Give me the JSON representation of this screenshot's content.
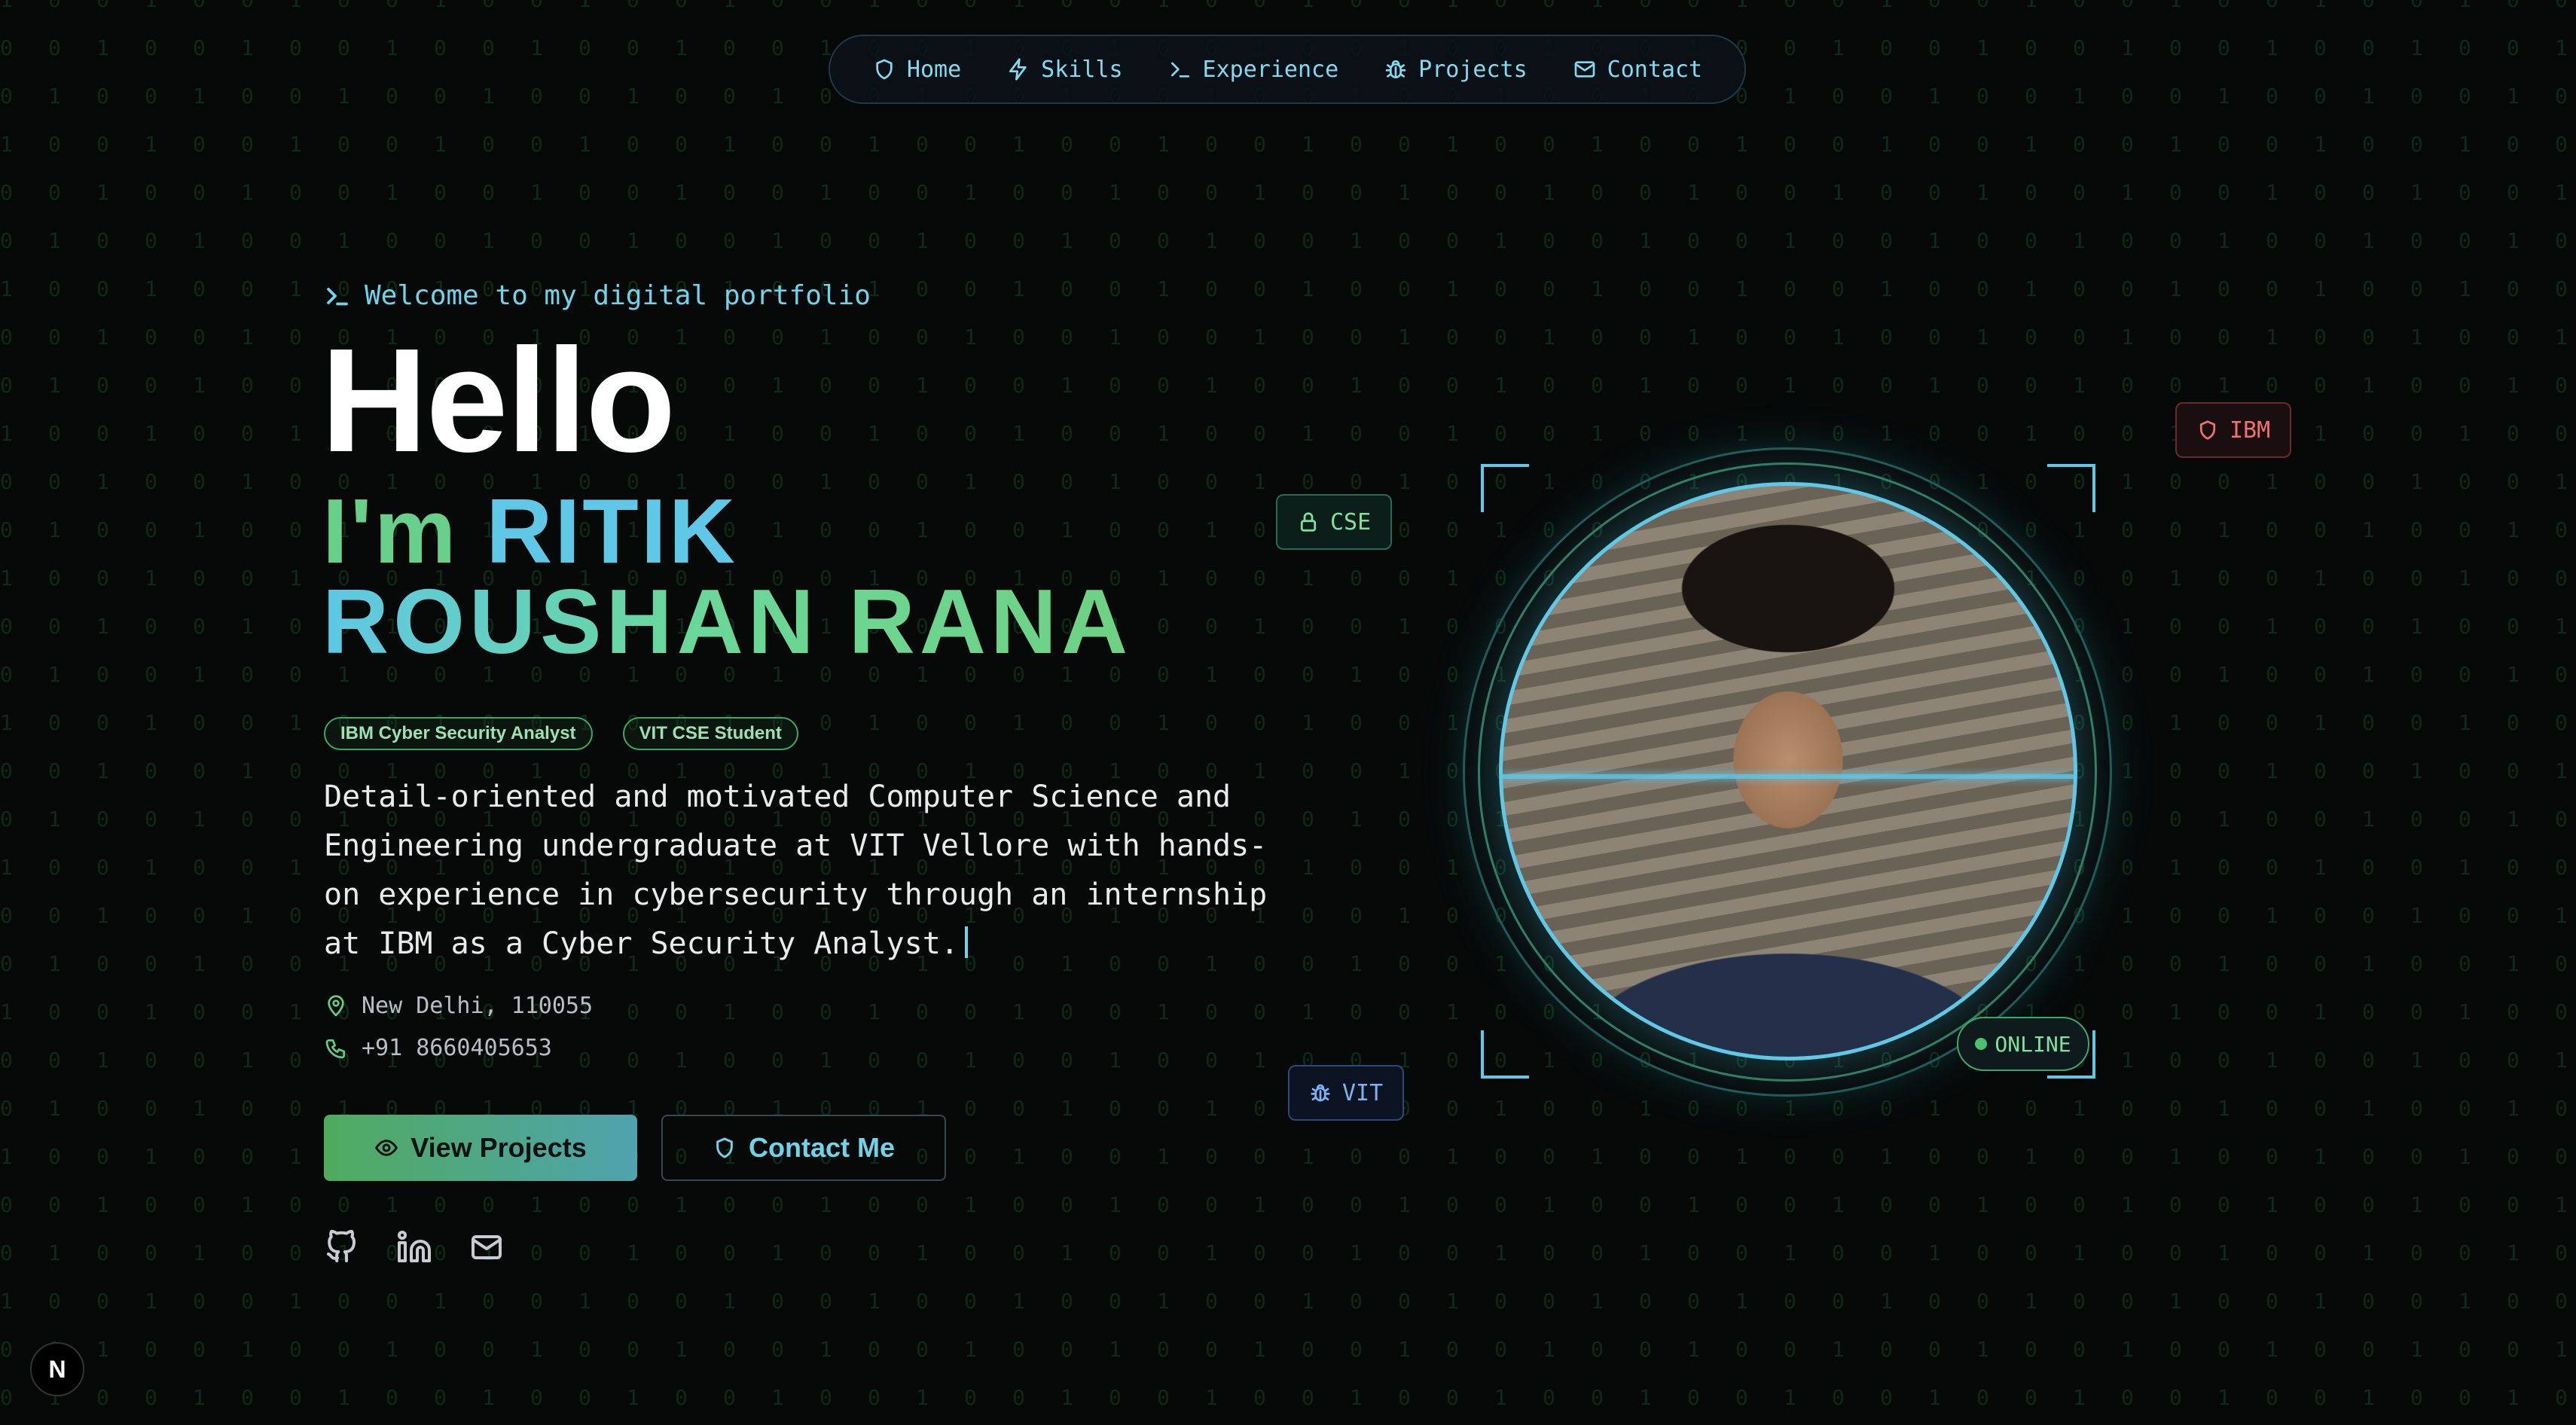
{
  "nav": {
    "items": [
      {
        "label": "Home",
        "icon": "shield-icon"
      },
      {
        "label": "Skills",
        "icon": "zap-icon"
      },
      {
        "label": "Experience",
        "icon": "terminal-icon"
      },
      {
        "label": "Projects",
        "icon": "bug-icon"
      },
      {
        "label": "Contact",
        "icon": "mail-icon"
      }
    ]
  },
  "hero": {
    "welcome": "Welcome to my digital portfolio",
    "hello": "Hello",
    "im": "I'm",
    "first_name": "RITIK",
    "last_name": "ROUSHAN RANA",
    "badges": [
      "IBM Cyber Security Analyst",
      "VIT CSE Student"
    ],
    "description": "Detail-oriented and motivated Computer Science and Engineering undergraduate at VIT Vellore with hands-on experience in cybersecurity through an internship at IBM as a Cyber Security Analyst.",
    "location": "New Delhi, 110055",
    "phone": "+91 8660405653",
    "primary_button": "View Projects",
    "secondary_button": "Contact Me",
    "socials": [
      "github-icon",
      "linkedin-icon",
      "mail-icon"
    ]
  },
  "profile": {
    "status": "ONLINE",
    "tags": {
      "cse": "CSE",
      "ibm": "IBM",
      "vit": "VIT"
    }
  },
  "dev_badge": "N",
  "colors": {
    "accent_cyan": "#5ec8e6",
    "accent_green": "#68d08a",
    "ibm_red": "#f07070",
    "vit_blue": "#7fb0f0",
    "background": "#070909"
  }
}
